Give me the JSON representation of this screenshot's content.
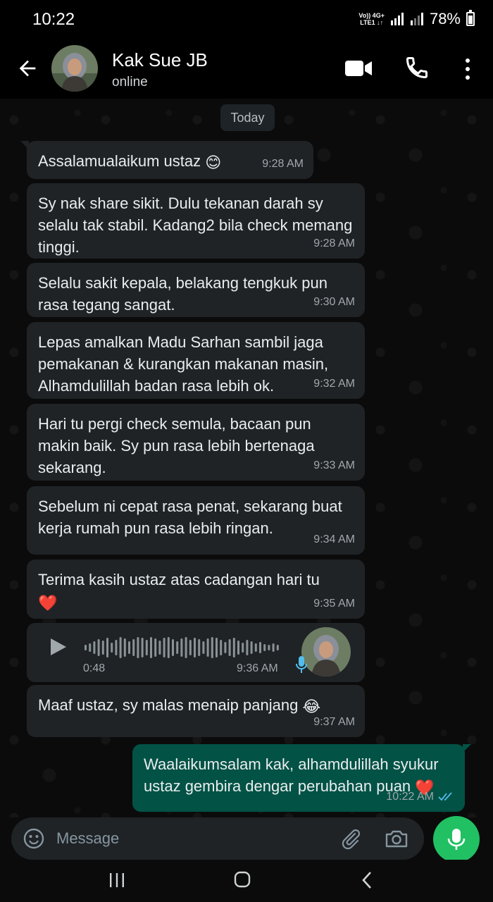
{
  "status_bar": {
    "time": "10:22",
    "net_top": "Vo)) 4G+",
    "net_bottom": "LTE1 ↓↑",
    "battery": "78%",
    "battery_level": 0.78
  },
  "header": {
    "contact_name": "Kak Sue JB",
    "status": "online"
  },
  "chat": {
    "day_label": "Today",
    "messages": [
      {
        "text": "Assalamualaikum ustaz",
        "emoji": "😊",
        "time": "9:28 AM"
      },
      {
        "text": "Sy nak share sikit. Dulu tekanan darah sy selalu tak stabil. Kadang2 bila check memang tinggi.",
        "time": "9:28 AM"
      },
      {
        "text": "Selalu sakit kepala, belakang tengkuk pun rasa tegang sangat.",
        "time": "9:30 AM"
      },
      {
        "text": "Lepas amalkan Madu Sarhan sambil jaga pemakanan & kurangkan makanan masin, Alhamdulillah badan rasa lebih ok.",
        "time": "9:32 AM"
      },
      {
        "text": "Hari tu pergi check semula, bacaan pun makin baik. Sy pun rasa lebih bertenaga sekarang.",
        "time": "9:33 AM"
      },
      {
        "text": "Sebelum ni cepat rasa penat, sekarang buat kerja rumah pun rasa lebih ringan.",
        "time": "9:34 AM"
      },
      {
        "text": "Terima kasih ustaz atas cadangan hari tu",
        "emoji": "❤️",
        "time": "9:35 AM"
      },
      {
        "text": "Maaf ustaz, sy malas menaip panjang",
        "emoji": "😂",
        "time": "9:37 AM"
      },
      {
        "text": "Waalaikumsalam kak, alhamdulillah syukur ustaz gembira dengar perubahan puan",
        "emoji": "❤️",
        "time": "10:22 AM"
      }
    ],
    "voice_note": {
      "duration": "0:48",
      "time": "9:36 AM"
    }
  },
  "composer": {
    "placeholder": "Message"
  },
  "colors": {
    "incoming_bubble": "#1f2326",
    "outgoing_bubble": "#025245",
    "accent": "#21c063",
    "read_ticks": "#53bdeb"
  }
}
